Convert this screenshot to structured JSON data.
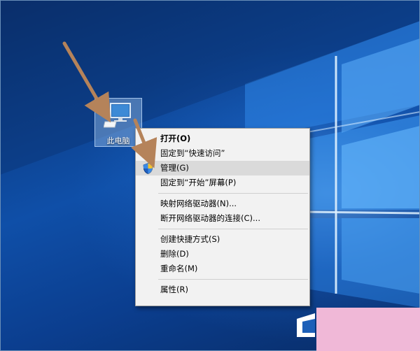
{
  "desktop": {
    "icon_label": "此电脑"
  },
  "context_menu": {
    "items": [
      {
        "label": "打开(O)"
      },
      {
        "label": "固定到“快速访问”"
      },
      {
        "label": "管理(G)"
      },
      {
        "label": "固定到“开始”屏幕(P)"
      },
      {
        "label": "映射网络驱动器(N)..."
      },
      {
        "label": "断开网络驱动器的连接(C)..."
      },
      {
        "label": "创建快捷方式(S)"
      },
      {
        "label": "删除(D)"
      },
      {
        "label": "重命名(M)"
      },
      {
        "label": "属性(R)"
      }
    ]
  },
  "colors": {
    "wallpaper": "#0f4fa8",
    "menu_bg": "#f2f2f2",
    "menu_hover": "#dadada",
    "arrow": "#b5835a",
    "corner_block": "#f0b8d7"
  },
  "icons": {
    "desktop_icon": "computer-monitor-icon",
    "uac": "uac-shield-icon"
  }
}
